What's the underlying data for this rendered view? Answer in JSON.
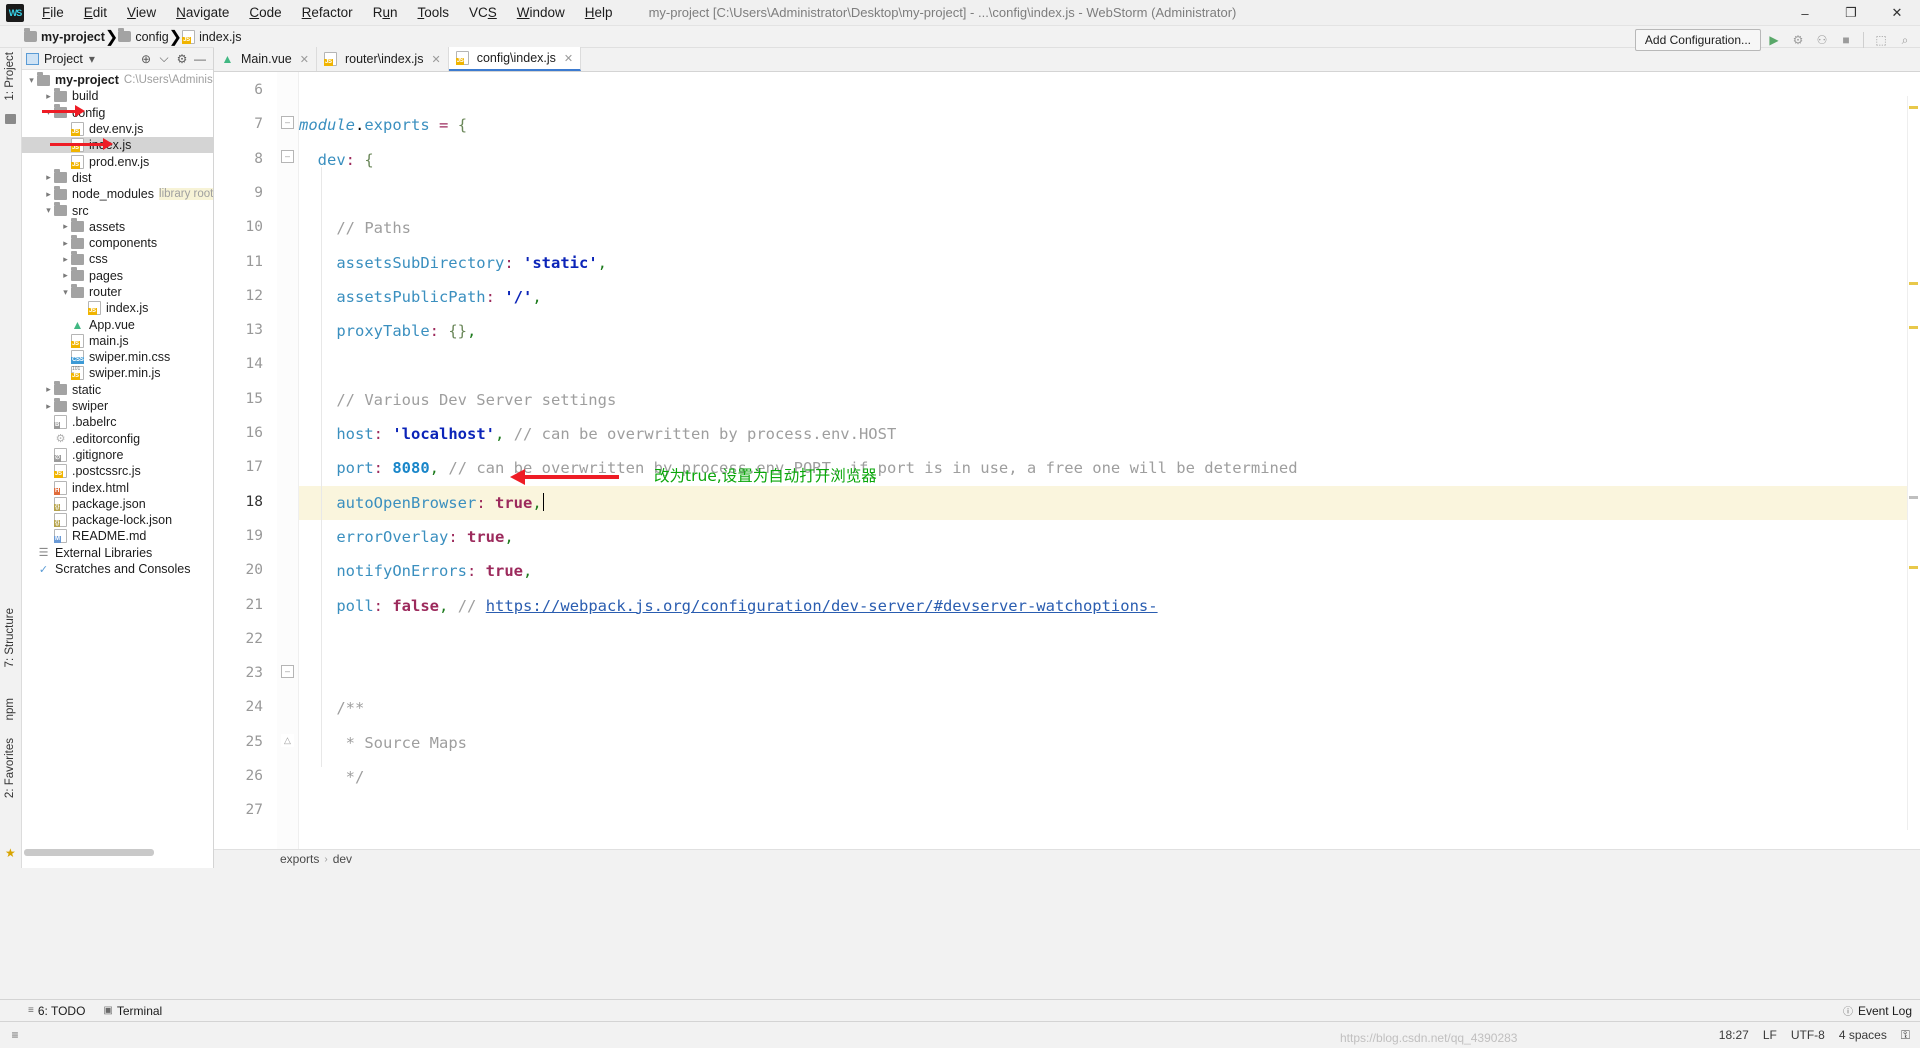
{
  "window": {
    "title": "my-project [C:\\Users\\Administrator\\Desktop\\my-project] - ...\\config\\index.js - WebStorm (Administrator)",
    "minimize": "–",
    "maximize": "❐",
    "close": "✕",
    "logo": "WS"
  },
  "menu": {
    "items": [
      "File",
      "Edit",
      "View",
      "Navigate",
      "Code",
      "Refactor",
      "Run",
      "Tools",
      "VCS",
      "Window",
      "Help"
    ]
  },
  "breadcrumb": {
    "project": "my-project",
    "folder": "config",
    "file": "index.js"
  },
  "toolbar": {
    "add_configuration": "Add Configuration...",
    "run_icon": "▶",
    "debug_icon": "⚙",
    "run_with_coverage_icon": "⚇",
    "stop_icon": "■",
    "layout_icon": "⬚",
    "search_icon": "⌕"
  },
  "left_strips": {
    "project": "1: Project",
    "structure": "7: Structure",
    "npm": "npm",
    "favorites": "2: Favorites",
    "star": "★"
  },
  "project_panel": {
    "title": "Project",
    "dropdown": "▾",
    "locate_icon": "⊕",
    "collapse_icon": "⌵",
    "settings_icon": "⚙",
    "hide_icon": "—",
    "tree": [
      {
        "depth": 0,
        "arrow": "down",
        "icon": "folder",
        "label": "my-project",
        "bold": true,
        "sub": "C:\\Users\\Administrato",
        "selected": false
      },
      {
        "depth": 1,
        "arrow": "right",
        "icon": "folder",
        "label": "build",
        "bold": false,
        "sub": "",
        "selected": false
      },
      {
        "depth": 1,
        "arrow": "down",
        "icon": "folder",
        "label": "config",
        "bold": false,
        "sub": "",
        "selected": false,
        "redarrow": true
      },
      {
        "depth": 2,
        "arrow": "none",
        "icon": "js",
        "label": "dev.env.js",
        "bold": false,
        "sub": "",
        "selected": false
      },
      {
        "depth": 2,
        "arrow": "none",
        "icon": "js",
        "label": "index.js",
        "bold": false,
        "sub": "",
        "selected": true,
        "redarrow": true
      },
      {
        "depth": 2,
        "arrow": "none",
        "icon": "js",
        "label": "prod.env.js",
        "bold": false,
        "sub": "",
        "selected": false
      },
      {
        "depth": 1,
        "arrow": "right",
        "icon": "folder",
        "label": "dist",
        "bold": false,
        "sub": "",
        "selected": false
      },
      {
        "depth": 1,
        "arrow": "right",
        "icon": "folder",
        "label": "node_modules",
        "bold": false,
        "sub": "library root",
        "selected": false,
        "yellow": true
      },
      {
        "depth": 1,
        "arrow": "down",
        "icon": "folder",
        "label": "src",
        "bold": false,
        "sub": "",
        "selected": false
      },
      {
        "depth": 2,
        "arrow": "right",
        "icon": "folder",
        "label": "assets",
        "bold": false,
        "sub": "",
        "selected": false
      },
      {
        "depth": 2,
        "arrow": "right",
        "icon": "folder",
        "label": "components",
        "bold": false,
        "sub": "",
        "selected": false
      },
      {
        "depth": 2,
        "arrow": "right",
        "icon": "folder",
        "label": "css",
        "bold": false,
        "sub": "",
        "selected": false
      },
      {
        "depth": 2,
        "arrow": "right",
        "icon": "folder",
        "label": "pages",
        "bold": false,
        "sub": "",
        "selected": false
      },
      {
        "depth": 2,
        "arrow": "down",
        "icon": "folder",
        "label": "router",
        "bold": false,
        "sub": "",
        "selected": false
      },
      {
        "depth": 3,
        "arrow": "none",
        "icon": "js",
        "label": "index.js",
        "bold": false,
        "sub": "",
        "selected": false
      },
      {
        "depth": 2,
        "arrow": "none",
        "icon": "vue",
        "label": "App.vue",
        "bold": false,
        "sub": "",
        "selected": false
      },
      {
        "depth": 2,
        "arrow": "none",
        "icon": "js",
        "label": "main.js",
        "bold": false,
        "sub": "",
        "selected": false
      },
      {
        "depth": 2,
        "arrow": "none",
        "icon": "css",
        "label": "swiper.min.css",
        "bold": false,
        "sub": "",
        "selected": false
      },
      {
        "depth": 2,
        "arrow": "none",
        "icon": "js101",
        "label": "swiper.min.js",
        "bold": false,
        "sub": "",
        "selected": false
      },
      {
        "depth": 1,
        "arrow": "right",
        "icon": "folder",
        "label": "static",
        "bold": false,
        "sub": "",
        "selected": false
      },
      {
        "depth": 1,
        "arrow": "right",
        "icon": "folder",
        "label": "swiper",
        "bold": false,
        "sub": "",
        "selected": false
      },
      {
        "depth": 1,
        "arrow": "none",
        "icon": "babel",
        "label": ".babelrc",
        "bold": false,
        "sub": "",
        "selected": false
      },
      {
        "depth": 1,
        "arrow": "none",
        "icon": "gear",
        "label": ".editorconfig",
        "bold": false,
        "sub": "",
        "selected": false
      },
      {
        "depth": 1,
        "arrow": "none",
        "icon": "git",
        "label": ".gitignore",
        "bold": false,
        "sub": "",
        "selected": false
      },
      {
        "depth": 1,
        "arrow": "none",
        "icon": "js",
        "label": ".postcssrc.js",
        "bold": false,
        "sub": "",
        "selected": false
      },
      {
        "depth": 1,
        "arrow": "none",
        "icon": "html",
        "label": "index.html",
        "bold": false,
        "sub": "",
        "selected": false
      },
      {
        "depth": 1,
        "arrow": "none",
        "icon": "json",
        "label": "package.json",
        "bold": false,
        "sub": "",
        "selected": false
      },
      {
        "depth": 1,
        "arrow": "none",
        "icon": "json",
        "label": "package-lock.json",
        "bold": false,
        "sub": "",
        "selected": false
      },
      {
        "depth": 1,
        "arrow": "none",
        "icon": "md",
        "label": "README.md",
        "bold": false,
        "sub": "",
        "selected": false
      },
      {
        "depth": 0,
        "arrow": "none",
        "icon": "lib",
        "label": "External Libraries",
        "bold": false,
        "sub": "",
        "selected": false
      },
      {
        "depth": 0,
        "arrow": "none",
        "icon": "scratch",
        "label": "Scratches and Consoles",
        "bold": false,
        "sub": "",
        "selected": false
      }
    ]
  },
  "editor": {
    "tabs": [
      {
        "label": "Main.vue",
        "icon": "vue",
        "active": false
      },
      {
        "label": "router\\index.js",
        "icon": "js",
        "active": false
      },
      {
        "label": "config\\index.js",
        "icon": "js",
        "active": true
      }
    ],
    "close_icon": "✕",
    "breadcrumb": {
      "exports": "exports",
      "dev": "dev",
      "sep": "›"
    },
    "line_numbers": [
      "6",
      "7",
      "8",
      "9",
      "10",
      "11",
      "12",
      "13",
      "14",
      "15",
      "16",
      "17",
      "18",
      "19",
      "20",
      "21",
      "22",
      "23",
      "24",
      "25",
      "26",
      "27"
    ],
    "highlighted_line": "18",
    "lines": [
      {
        "num": "6",
        "tokens": []
      },
      {
        "num": "7",
        "tokens": [
          {
            "t": "module",
            "c": "t-mod"
          },
          {
            "t": ".",
            "c": "t-punc-plain"
          },
          {
            "t": "exports",
            "c": "t-prop"
          },
          {
            "t": " ",
            "c": "plain"
          },
          {
            "t": "=",
            "c": "t-op"
          },
          {
            "t": " ",
            "c": "plain"
          },
          {
            "t": "{",
            "c": "t-brace"
          }
        ]
      },
      {
        "num": "8",
        "tokens": [
          {
            "t": "  ",
            "c": "plain"
          },
          {
            "t": "dev",
            "c": "t-prop"
          },
          {
            "t": ":",
            "c": "t-colon"
          },
          {
            "t": " ",
            "c": "plain"
          },
          {
            "t": "{",
            "c": "t-brace"
          }
        ]
      },
      {
        "num": "9",
        "tokens": []
      },
      {
        "num": "10",
        "tokens": [
          {
            "t": "    ",
            "c": "plain"
          },
          {
            "t": "// Paths",
            "c": "t-com"
          }
        ]
      },
      {
        "num": "11",
        "tokens": [
          {
            "t": "    ",
            "c": "plain"
          },
          {
            "t": "assetsSubDirectory",
            "c": "t-prop"
          },
          {
            "t": ":",
            "c": "t-colon"
          },
          {
            "t": " ",
            "c": "plain"
          },
          {
            "t": "'static'",
            "c": "t-str"
          },
          {
            "t": ",",
            "c": "t-punc"
          }
        ]
      },
      {
        "num": "12",
        "tokens": [
          {
            "t": "    ",
            "c": "plain"
          },
          {
            "t": "assetsPublicPath",
            "c": "t-prop"
          },
          {
            "t": ":",
            "c": "t-colon"
          },
          {
            "t": " ",
            "c": "plain"
          },
          {
            "t": "'/'",
            "c": "t-str"
          },
          {
            "t": ",",
            "c": "t-punc"
          }
        ]
      },
      {
        "num": "13",
        "tokens": [
          {
            "t": "    ",
            "c": "plain"
          },
          {
            "t": "proxyTable",
            "c": "t-prop"
          },
          {
            "t": ":",
            "c": "t-colon"
          },
          {
            "t": " ",
            "c": "plain"
          },
          {
            "t": "{}",
            "c": "t-brace"
          },
          {
            "t": ",",
            "c": "t-punc"
          }
        ]
      },
      {
        "num": "14",
        "tokens": []
      },
      {
        "num": "15",
        "tokens": [
          {
            "t": "    ",
            "c": "plain"
          },
          {
            "t": "// Various Dev Server settings",
            "c": "t-com"
          }
        ]
      },
      {
        "num": "16",
        "tokens": [
          {
            "t": "    ",
            "c": "plain"
          },
          {
            "t": "host",
            "c": "t-prop"
          },
          {
            "t": ":",
            "c": "t-colon"
          },
          {
            "t": " ",
            "c": "plain"
          },
          {
            "t": "'localhost'",
            "c": "t-str"
          },
          {
            "t": ",",
            "c": "t-punc"
          },
          {
            "t": " ",
            "c": "plain"
          },
          {
            "t": "// can be overwritten by process.env.HOST",
            "c": "t-com"
          }
        ]
      },
      {
        "num": "17",
        "tokens": [
          {
            "t": "    ",
            "c": "plain"
          },
          {
            "t": "port",
            "c": "t-prop"
          },
          {
            "t": ":",
            "c": "t-colon"
          },
          {
            "t": " ",
            "c": "plain"
          },
          {
            "t": "8080",
            "c": "t-num"
          },
          {
            "t": ",",
            "c": "t-punc"
          },
          {
            "t": " ",
            "c": "plain"
          },
          {
            "t": "// can be overwritten by process.env.PORT, if port is in use, a free one will be determined",
            "c": "t-com"
          }
        ]
      },
      {
        "num": "18",
        "tokens": [
          {
            "t": "    ",
            "c": "plain"
          },
          {
            "t": "autoOpenBrowser",
            "c": "t-prop"
          },
          {
            "t": ":",
            "c": "t-colon"
          },
          {
            "t": " ",
            "c": "plain"
          },
          {
            "t": "true",
            "c": "t-bool"
          },
          {
            "t": ",",
            "c": "t-punc"
          }
        ],
        "caret": true
      },
      {
        "num": "19",
        "tokens": [
          {
            "t": "    ",
            "c": "plain"
          },
          {
            "t": "errorOverlay",
            "c": "t-prop"
          },
          {
            "t": ":",
            "c": "t-colon"
          },
          {
            "t": " ",
            "c": "plain"
          },
          {
            "t": "true",
            "c": "t-bool"
          },
          {
            "t": ",",
            "c": "t-punc"
          }
        ]
      },
      {
        "num": "20",
        "tokens": [
          {
            "t": "    ",
            "c": "plain"
          },
          {
            "t": "notifyOnErrors",
            "c": "t-prop"
          },
          {
            "t": ":",
            "c": "t-colon"
          },
          {
            "t": " ",
            "c": "plain"
          },
          {
            "t": "true",
            "c": "t-bool"
          },
          {
            "t": ",",
            "c": "t-punc"
          }
        ]
      },
      {
        "num": "21",
        "tokens": [
          {
            "t": "    ",
            "c": "plain"
          },
          {
            "t": "poll",
            "c": "t-prop"
          },
          {
            "t": ":",
            "c": "t-colon"
          },
          {
            "t": " ",
            "c": "plain"
          },
          {
            "t": "false",
            "c": "t-bool"
          },
          {
            "t": ",",
            "c": "t-punc"
          },
          {
            "t": " ",
            "c": "plain"
          },
          {
            "t": "// ",
            "c": "t-com"
          },
          {
            "t": "https://webpack.js.org/configuration/dev-server/#devserver-watchoptions-",
            "c": "t-link"
          }
        ]
      },
      {
        "num": "22",
        "tokens": []
      },
      {
        "num": "23",
        "tokens": []
      },
      {
        "num": "24",
        "tokens": [
          {
            "t": "    ",
            "c": "plain"
          },
          {
            "t": "/**",
            "c": "t-com"
          }
        ]
      },
      {
        "num": "25",
        "tokens": [
          {
            "t": "     ",
            "c": "plain"
          },
          {
            "t": "* Source Maps",
            "c": "t-com"
          }
        ]
      },
      {
        "num": "26",
        "tokens": [
          {
            "t": "     ",
            "c": "plain"
          },
          {
            "t": "*/",
            "c": "t-com"
          }
        ]
      },
      {
        "num": "27",
        "tokens": []
      }
    ],
    "annotation": {
      "text": "改为true,设置为自动打开浏览器",
      "color": "#0aa60a",
      "arrow_color": "#ee1c25"
    }
  },
  "bottom_bar": {
    "todo": "6: TODO",
    "todo_icon": "≡",
    "terminal": "Terminal",
    "terminal_icon": "▣",
    "event_log": "Event Log",
    "event_log_icon": "ⓘ"
  },
  "status_bar": {
    "time": "18:27",
    "line_sep": "LF",
    "encoding": "UTF-8",
    "indent": "4 spaces",
    "lock_icon": "⚿",
    "menu_icon": "≡",
    "watermark": "https://blog.csdn.net/qq_4390283"
  },
  "colors": {
    "accent": "#3c7bd0",
    "highlight_row": "#faf5dd",
    "selection": "#d4d4d4",
    "annotation_green": "#0aa60a",
    "arrow_red": "#ee1c25",
    "vue_green": "#42b883",
    "js_yellow": "#f0b400"
  }
}
